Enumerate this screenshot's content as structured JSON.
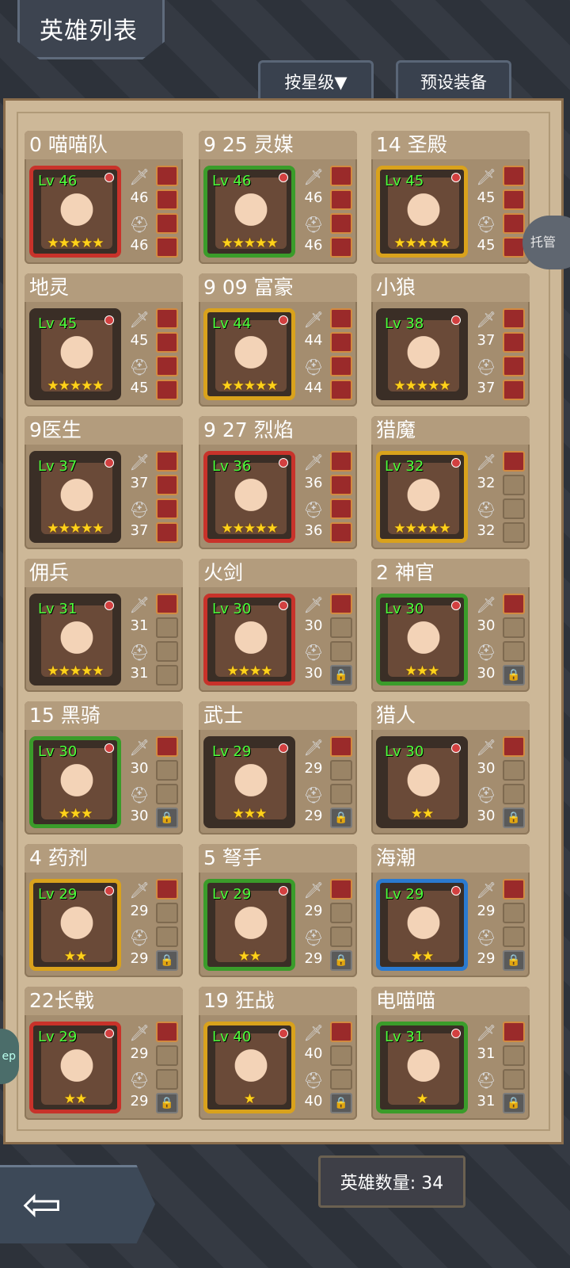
{
  "header": {
    "title": "英雄列表",
    "sort_button": "按星级▼",
    "preset_button": "预设装备"
  },
  "auto_button": "托管",
  "side_button": "ep",
  "footer": {
    "hero_count_label": "英雄数量: 34",
    "back_icon": "arrow-left-icon"
  },
  "colors": {
    "star": "#ffd21a",
    "level": "#4cff3a",
    "panel": "#cdb898",
    "card": "#a48d6f"
  },
  "heroes": [
    {
      "name": "0 喵喵队",
      "level": "Lv 46",
      "weapon": "46",
      "armor": "46",
      "stars": "★★★★★",
      "frame": "#c8322a"
    },
    {
      "name": "9 25 灵媒",
      "level": "Lv 46",
      "weapon": "46",
      "armor": "46",
      "stars": "★★★★★",
      "frame": "#3a9c2a"
    },
    {
      "name": "14 圣殿",
      "level": "Lv 45",
      "weapon": "45",
      "armor": "45",
      "stars": "★★★★★",
      "frame": "#d9a21c"
    },
    {
      "name": "地灵",
      "level": "Lv 45",
      "weapon": "45",
      "armor": "45",
      "stars": "★★★★★",
      "frame": "#3a2e26"
    },
    {
      "name": "9 09 富豪",
      "level": "Lv 44",
      "weapon": "44",
      "armor": "44",
      "stars": "★★★★★",
      "frame": "#d9a21c"
    },
    {
      "name": "小狼",
      "level": "Lv 38",
      "weapon": "37",
      "armor": "37",
      "stars": "★★★★★",
      "frame": "#3a2e26"
    },
    {
      "name": "9医生",
      "level": "Lv 37",
      "weapon": "37",
      "armor": "37",
      "stars": "★★★★★",
      "frame": "#3a2e26"
    },
    {
      "name": "9 27 烈焰",
      "level": "Lv 36",
      "weapon": "36",
      "armor": "36",
      "stars": "★★★★★",
      "frame": "#c8322a"
    },
    {
      "name": "猎魔",
      "level": "Lv 32",
      "weapon": "32",
      "armor": "32",
      "stars": "★★★★★",
      "frame": "#d9a21c"
    },
    {
      "name": "佣兵",
      "level": "Lv 31",
      "weapon": "31",
      "armor": "31",
      "stars": "★★★★★",
      "frame": "#3a2e26"
    },
    {
      "name": "火剑",
      "level": "Lv 30",
      "weapon": "30",
      "armor": "30",
      "stars": "★★★★",
      "frame": "#c8322a"
    },
    {
      "name": "2 神官",
      "level": "Lv 30",
      "weapon": "30",
      "armor": "30",
      "stars": "★★★",
      "frame": "#3a9c2a"
    },
    {
      "name": "15 黑骑",
      "level": "Lv 30",
      "weapon": "30",
      "armor": "30",
      "stars": "★★★",
      "frame": "#3a9c2a"
    },
    {
      "name": "武士",
      "level": "Lv 29",
      "weapon": "29",
      "armor": "29",
      "stars": "★★★",
      "frame": "#3a2e26"
    },
    {
      "name": "猎人",
      "level": "Lv 30",
      "weapon": "30",
      "armor": "30",
      "stars": "★★",
      "frame": "#3a2e26"
    },
    {
      "name": "4 药剂",
      "level": "Lv 29",
      "weapon": "29",
      "armor": "29",
      "stars": "★★",
      "frame": "#d9a21c"
    },
    {
      "name": "5 弩手",
      "level": "Lv 29",
      "weapon": "29",
      "armor": "29",
      "stars": "★★",
      "frame": "#3a9c2a"
    },
    {
      "name": "海潮",
      "level": "Lv 29",
      "weapon": "29",
      "armor": "29",
      "stars": "★★",
      "frame": "#2a7ad0"
    },
    {
      "name": "22长戟",
      "level": "Lv 29",
      "weapon": "29",
      "armor": "29",
      "stars": "★★",
      "frame": "#c8322a"
    },
    {
      "name": "19 狂战",
      "level": "Lv 40",
      "weapon": "40",
      "armor": "40",
      "stars": "★",
      "frame": "#d9a21c"
    },
    {
      "name": "电喵喵",
      "level": "Lv 31",
      "weapon": "31",
      "armor": "31",
      "stars": "★",
      "frame": "#3a9c2a"
    }
  ],
  "slot_states": [
    [
      "filled",
      "filled",
      "filled",
      "filled"
    ],
    [
      "filled",
      "filled",
      "filled",
      "filled"
    ],
    [
      "filled",
      "filled",
      "filled",
      "filled"
    ],
    [
      "filled",
      "filled",
      "filled",
      "filled"
    ],
    [
      "filled",
      "filled",
      "filled",
      "filled"
    ],
    [
      "filled",
      "filled",
      "filled",
      "filled"
    ],
    [
      "filled",
      "filled",
      "filled",
      "filled"
    ],
    [
      "filled",
      "filled",
      "filled",
      "filled"
    ],
    [
      "filled",
      "empty",
      "empty",
      "empty"
    ],
    [
      "filled",
      "empty",
      "empty",
      "empty"
    ],
    [
      "filled",
      "empty",
      "empty",
      "lock"
    ],
    [
      "filled",
      "empty",
      "empty",
      "lock"
    ],
    [
      "filled",
      "empty",
      "empty",
      "lock"
    ],
    [
      "filled",
      "empty",
      "empty",
      "lock"
    ],
    [
      "filled",
      "empty",
      "empty",
      "lock"
    ],
    [
      "filled",
      "empty",
      "empty",
      "lock"
    ],
    [
      "filled",
      "empty",
      "empty",
      "lock"
    ],
    [
      "filled",
      "empty",
      "empty",
      "lock"
    ],
    [
      "filled",
      "empty",
      "empty",
      "lock"
    ],
    [
      "filled",
      "empty",
      "empty",
      "lock"
    ],
    [
      "filled",
      "empty",
      "empty",
      "lock"
    ]
  ]
}
